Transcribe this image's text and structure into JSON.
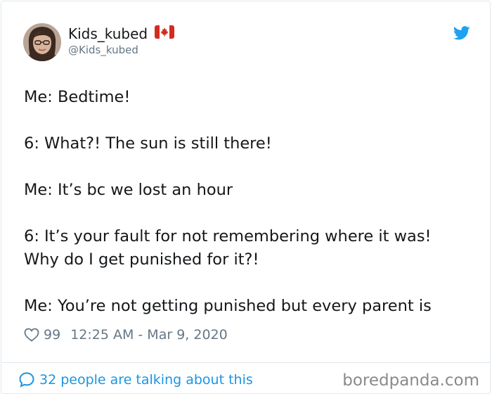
{
  "user": {
    "display_name": "Kids_kubed",
    "handle": "@Kids_kubed",
    "flag_icon": "canada-flag-icon"
  },
  "tweet": {
    "lines": [
      "Me: Bedtime!",
      "6: What?! The sun is still there!",
      "Me: It’s bc we lost an hour",
      "6: It’s your fault for not remembering where it was!",
      "Why do I get punished for it?!",
      "Me: You’re not getting punished but every parent is"
    ],
    "likes": "99",
    "timestamp": "12:25 AM - Mar 9, 2020"
  },
  "footer": {
    "conversation_label": "32 people are talking about this"
  },
  "watermark": "boredpanda.com",
  "colors": {
    "twitter_blue": "#1da1f2",
    "link_blue": "#1b95e0",
    "meta_gray": "#657786",
    "canada_red": "#d52b1e"
  }
}
